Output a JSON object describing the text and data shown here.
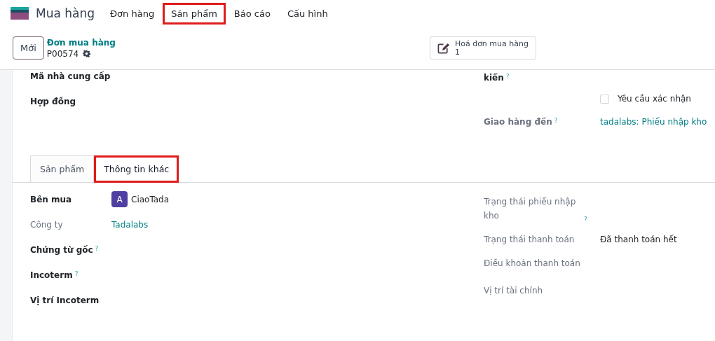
{
  "app": {
    "title": "Mua hàng"
  },
  "menu": [
    {
      "label": "Đơn hàng",
      "highlighted": false
    },
    {
      "label": "Sản phẩm",
      "highlighted": true
    },
    {
      "label": "Báo cáo",
      "highlighted": false
    },
    {
      "label": "Cấu hình",
      "highlighted": false
    }
  ],
  "control_bar": {
    "new_button": "Mới",
    "breadcrumb": "Đơn mua hàng",
    "record": "P00574",
    "smart_button": {
      "label": "Hoá đơn mua hàng",
      "count": "1"
    }
  },
  "top_left_fields": [
    {
      "label": "Mã nhà cung cấp"
    },
    {
      "label": "Hợp đồng"
    }
  ],
  "top_right": {
    "date_label_tail": "kiến",
    "confirm_checkbox": {
      "label": "Yêu cầu xác nhận",
      "checked": false
    },
    "deliver_to": {
      "label": "Giao hàng đến",
      "value": "tadalabs: Phiếu nhập kho"
    }
  },
  "tabs": [
    {
      "label": "Sản phẩm",
      "selected": false,
      "highlighted": false
    },
    {
      "label": "Thông tin khác",
      "selected": true,
      "highlighted": true
    }
  ],
  "left_fields": [
    {
      "label": "Bên mua",
      "kind": "user",
      "value": "CiaoTada",
      "avatar": "A",
      "bold": true,
      "help": false
    },
    {
      "label": "Công ty",
      "kind": "link",
      "value": "Tadalabs",
      "bold": false,
      "help": false
    },
    {
      "label": "Chứng từ gốc",
      "kind": "empty",
      "bold": true,
      "help": true
    },
    {
      "label": "Incoterm",
      "kind": "empty",
      "bold": true,
      "help": true
    },
    {
      "label": "Vị trí Incoterm",
      "kind": "empty",
      "bold": true,
      "help": false
    }
  ],
  "right_fields": [
    {
      "label": "Trạng thái phiếu nhập kho",
      "kind": "empty",
      "help": true
    },
    {
      "label": "Trạng thái thanh toán",
      "kind": "text",
      "value": "Đã thanh toán hết",
      "help": false
    },
    {
      "label": "Điều khoản thanh toán",
      "kind": "empty",
      "help": false
    },
    {
      "label": "Vị trí tài chính",
      "kind": "empty",
      "help": false
    }
  ],
  "help_mark": "?"
}
